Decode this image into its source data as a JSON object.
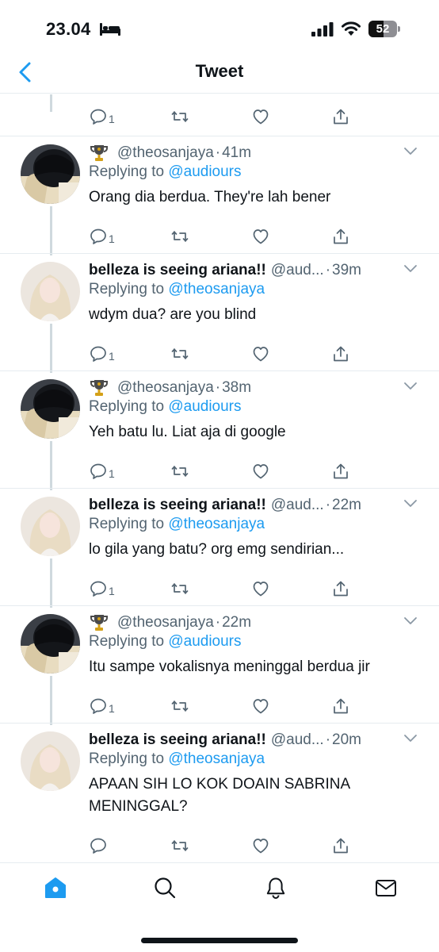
{
  "status_bar": {
    "time": "23.04",
    "battery": "52",
    "battery_level": 0.52,
    "icons": [
      "bed-icon",
      "signal-icon",
      "wifi-icon",
      "battery-icon"
    ]
  },
  "nav": {
    "title": "Tweet",
    "back_icon": "chevron-left-icon"
  },
  "colors": {
    "accent": "#1d9bf0",
    "text": "#0f1419",
    "secondary": "#536471",
    "divider": "#e6ecf0"
  },
  "top_actions": {
    "reply_count": "1"
  },
  "tweets": [
    {
      "display_name": "",
      "handle": "@theosanjaya",
      "dot": "·",
      "time": "41m",
      "replying_prefix": "Replying to ",
      "replying_to": "@audiours",
      "text": "Orang dia berdua. They're lah bener",
      "reply_count": "1",
      "avatar": "dark-hair-avatar"
    },
    {
      "display_name": "belleza is seeing ariana!!",
      "handle": "@aud...",
      "dot": "·",
      "time": "39m",
      "replying_prefix": "Replying to ",
      "replying_to": "@theosanjaya",
      "text": "wdym dua? are you blind",
      "reply_count": "1",
      "avatar": "blonde-avatar"
    },
    {
      "display_name": "",
      "handle": "@theosanjaya",
      "dot": "·",
      "time": "38m",
      "replying_prefix": "Replying to ",
      "replying_to": "@audiours",
      "text": "Yeh batu lu. Liat aja di google",
      "reply_count": "1",
      "avatar": "dark-hair-avatar"
    },
    {
      "display_name": "belleza is seeing ariana!!",
      "handle": "@aud...",
      "dot": "·",
      "time": "22m",
      "replying_prefix": "Replying to ",
      "replying_to": "@theosanjaya",
      "text": "lo gila yang batu? org emg sendirian...",
      "reply_count": "1",
      "avatar": "blonde-avatar"
    },
    {
      "display_name": "",
      "handle": "@theosanjaya",
      "dot": "·",
      "time": "22m",
      "replying_prefix": "Replying to ",
      "replying_to": "@audiours",
      "text": "Itu sampe vokalisnya meninggal berdua jir",
      "reply_count": "1",
      "avatar": "dark-hair-avatar"
    },
    {
      "display_name": "belleza is seeing ariana!!",
      "handle": "@aud...",
      "dot": "·",
      "time": "20m",
      "replying_prefix": "Replying to ",
      "replying_to": "@theosanjaya",
      "text": "APAAN SIH LO KOK DOAIN SABRINA MENINGGAL?",
      "reply_count": "",
      "avatar": "blonde-avatar"
    }
  ],
  "tab_bar": {
    "tabs": [
      "home-icon",
      "search-icon",
      "bell-icon",
      "mail-icon"
    ],
    "active": "home-icon"
  }
}
